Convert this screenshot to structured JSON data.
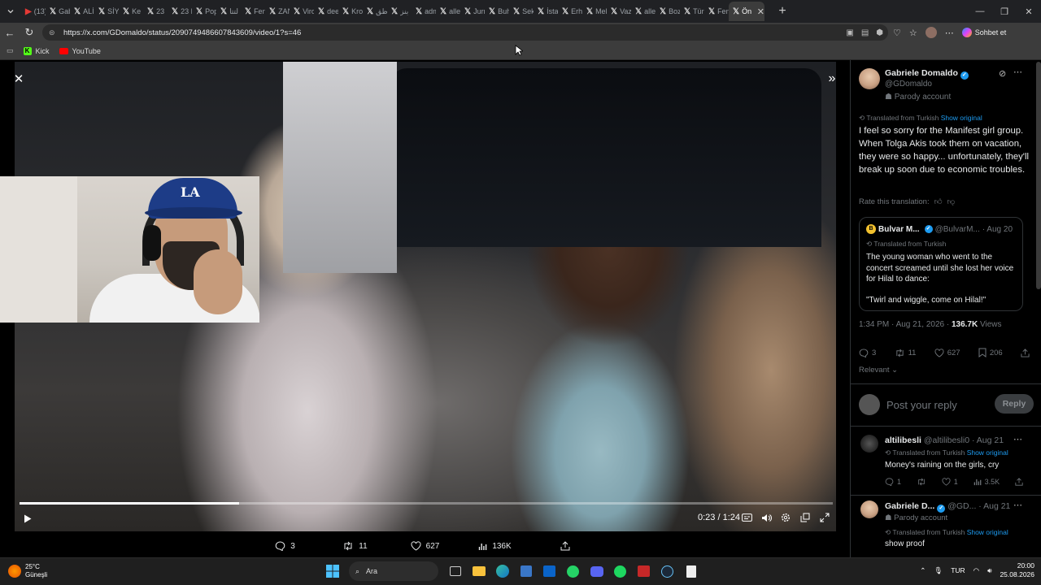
{
  "browser": {
    "tabs": [
      {
        "icon": "youtube-icon",
        "title": "(13)"
      },
      {
        "icon": "x-icon",
        "title": "Gab"
      },
      {
        "icon": "x-icon",
        "title": "ALİ"
      },
      {
        "icon": "x-icon",
        "title": "SİYA"
      },
      {
        "icon": "x-icon",
        "title": "Ke"
      },
      {
        "icon": "x-icon",
        "title": "23"
      },
      {
        "icon": "x-icon",
        "title": "23 E"
      },
      {
        "icon": "x-icon",
        "title": "Pop"
      },
      {
        "icon": "x-icon",
        "title": "لتتا"
      },
      {
        "icon": "x-icon",
        "title": "Fen"
      },
      {
        "icon": "x-icon",
        "title": "ZAN"
      },
      {
        "icon": "x-icon",
        "title": "Viro"
      },
      {
        "icon": "x-icon",
        "title": "dee"
      },
      {
        "icon": "x-icon",
        "title": "Kro"
      },
      {
        "icon": "x-icon",
        "title": "ظق"
      },
      {
        "icon": "x-icon",
        "title": "بنز"
      },
      {
        "icon": "x-icon",
        "title": "adm"
      },
      {
        "icon": "x-icon",
        "title": "alle"
      },
      {
        "icon": "x-icon",
        "title": "Jurr"
      },
      {
        "icon": "x-icon",
        "title": "Buh"
      },
      {
        "icon": "x-icon",
        "title": "Sek"
      },
      {
        "icon": "x-icon",
        "title": "İsta"
      },
      {
        "icon": "x-icon",
        "title": "Erh"
      },
      {
        "icon": "x-icon",
        "title": "Mel"
      },
      {
        "icon": "x-icon",
        "title": "Vaz"
      },
      {
        "icon": "x-icon",
        "title": "alle"
      },
      {
        "icon": "x-icon",
        "title": "Boz"
      },
      {
        "icon": "x-icon",
        "title": "Türk"
      },
      {
        "icon": "x-icon",
        "title": "Fen"
      },
      {
        "icon": "x-icon",
        "title": "Ön"
      }
    ],
    "address": "https://x.com/GDomaldo/status/2090749486607843609/video/1?s=46",
    "bookmarks": [
      {
        "icon": "kick-icon",
        "label": "Kick"
      },
      {
        "icon": "youtube-icon",
        "label": "YouTube"
      }
    ],
    "copilot_label": "Sohbet et"
  },
  "video": {
    "time": "0:23 / 1:24",
    "progress": 0.27,
    "actions": {
      "replies": "3",
      "reposts": "11",
      "likes": "627",
      "views": "136K"
    }
  },
  "panel": {
    "author": {
      "name": "Gabriele Domaldo",
      "handle": "@GDomaldo",
      "tag": "Parody account"
    },
    "translated_from": "Translated from Turkish",
    "show_original": "Show original",
    "text": "I feel so sorry for the Manifest girl group. When Tolga Akis took them on vacation, they were so happy... unfortunately, they'll break up soon due to economic troubles.",
    "rate": "Rate this translation:",
    "quote": {
      "name": "Bulvar M...",
      "handle": "@BulvarM...",
      "date": "· Aug 20",
      "translated": "Translated from Turkish",
      "text1": "The young woman who went to the concert screamed until she lost her voice for Hilal to dance:",
      "text2": "\"Twirl and wiggle, come on Hilal!\""
    },
    "meta": {
      "time": "1:34 PM · Aug 21, 2026 · ",
      "views": "136.7K",
      "views_label": " Views"
    },
    "stats": {
      "replies": "3",
      "reposts": "11",
      "likes": "627",
      "bookmarks": "206"
    },
    "sort": "Relevant",
    "reply_placeholder": "Post your reply",
    "reply_button": "Reply",
    "replies": [
      {
        "name": "altilibesli",
        "handle": "@altilibesli0 · Aug 21",
        "translated": "Translated from Turkish",
        "show": "Show original",
        "text": "Money's raining on the girls, cry",
        "stats": {
          "replies": "1",
          "reposts": "",
          "likes": "1",
          "views": "3.5K"
        }
      },
      {
        "name": "Gabriele D...",
        "handle": "@GD... · Aug 21",
        "tag": "Parody account",
        "translated": "Translated from Turkish",
        "show": "Show original",
        "text": "show proof"
      }
    ]
  },
  "taskbar": {
    "temp": "25°C",
    "weather": "Güneşli",
    "search": "Ara",
    "lang": "TUR",
    "time": "20:00",
    "date": "25.08.2026"
  }
}
